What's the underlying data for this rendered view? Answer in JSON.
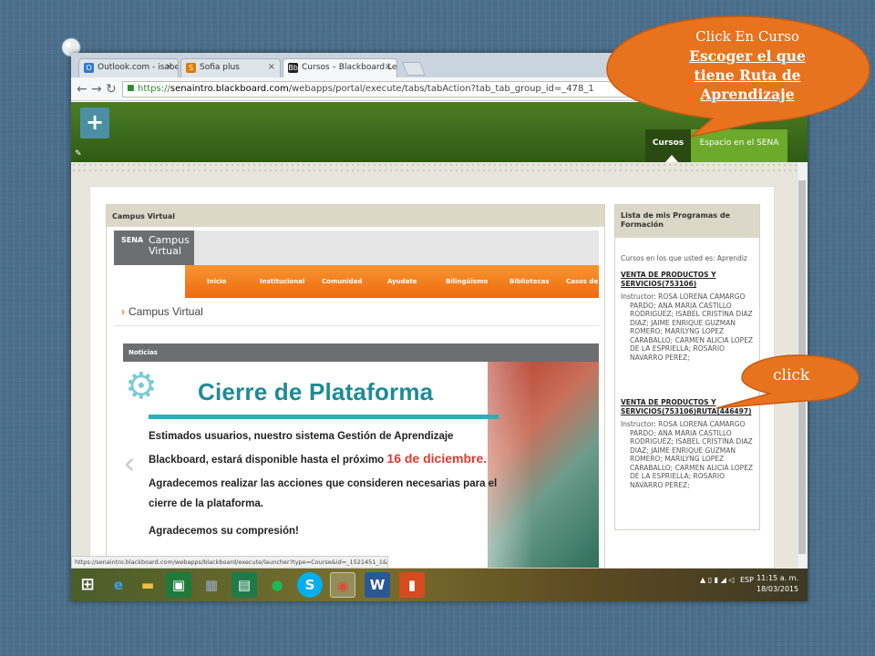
{
  "browser": {
    "tabs": [
      {
        "label": "Outlook.com - isabelcristi",
        "close": "×",
        "favicon": "O",
        "favicon_color": "#2e7bcf"
      },
      {
        "label": "Sofia plus",
        "close": "×",
        "favicon": "S",
        "favicon_color": "#e07b00"
      },
      {
        "label": "Cursos – Blackboard Learn",
        "close": "×",
        "favicon": "Bb",
        "favicon_color": "#222222"
      }
    ],
    "url_secure": "https://",
    "url_host": "senaintro.blackboard.com",
    "url_path": "/webapps/portal/execute/tabs/tabAction?tab_tab_group_id=_478_1"
  },
  "header": {
    "plus": "+",
    "tab_cursos": "Cursos",
    "tab_espacio": "Espacio en el SENA"
  },
  "campus": {
    "module_title": "Campus Virtual",
    "logo_mark": "SENA",
    "logo_text_1": "Campus",
    "logo_text_2": "Virtual",
    "nav": [
      "Inicio",
      "Institucional",
      "Comunidad",
      "Ayudate",
      "Bilingüismo",
      "Bibliotecas",
      "Casos de"
    ],
    "breadcrumb": "Campus Virtual",
    "noticias": "Noticias",
    "banner_title": "Cierre de Plataforma",
    "banner_lines": [
      "Estimados usuarios, nuestro sistema Gestión de Aprendizaje",
      "Blackboard, estará disponible hasta el próximo",
      "Agradecemos realizar las acciones que consideren necesarias para el",
      "cierre de la  plataforma.",
      "Agradecemos su compresión!"
    ],
    "banner_date": "16 de diciembre."
  },
  "programs": {
    "title": "Lista de mis Programas de Formación",
    "subtitle": "Cursos en los que usted es: Aprendiz",
    "course1": "VENTA DE PRODUCTOS Y SERVICIOS(753106)",
    "course1_instructor": "Instructor: ROSA LORENA CAMARGO PARDO;  ANA MARIA CASTILLO RODRIGUEZ;  ISABEL CRISTINA DIAZ DIAZ;  JAIME ENRIQUE GUZMAN ROMERO;  MARILYNG LOPEZ CARABALLO;  CARMEN ALICIA LOPEZ DE LA ESPRIELLA;  ROSARIO NAVARRO PEREZ;",
    "course2": "VENTA DE PRODUCTOS Y SERVICIOS(753106)RUTA(446497)",
    "course2_instructor": "Instructor: ROSA LORENA CAMARGO PARDO;  ANA MARIA CASTILLO RODRIGUEZ;  ISABEL CRISTINA DIAZ DIAZ;  JAIME ENRIQUE GUZMAN ROMERO;  MARILYNG LOPEZ CARABALLO;  CARMEN ALICIA LOPEZ DE LA ESPRIELLA;  ROSARIO NAVARRO PEREZ;"
  },
  "status_url": "https://senaintro.blackboard.com/webapps/blackboard/execute/launcher?type=Course&id=_1521451_1&url=",
  "taskbar": {
    "lang": "ESP",
    "time": "11:15 a. m.",
    "date": "18/03/2015"
  },
  "callouts": {
    "c1_line1": "Click  En Curso",
    "c1_line2": "Escoger  el que",
    "c1_line3": "tiene Ruta de",
    "c1_line4": "Aprendizaje",
    "c2": "click",
    "color": "#e8731e"
  }
}
